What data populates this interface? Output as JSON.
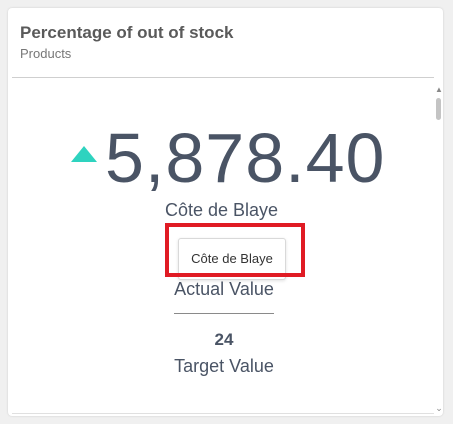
{
  "widget": {
    "title": "Percentage of out of stock",
    "subtitle": "Products"
  },
  "kpi": {
    "trend_icon": "triangle-up-icon",
    "trend_color": "#2ed3bf",
    "value": "5,878.40",
    "category": "Côte de Blaye",
    "actual_label": "Actual Value",
    "target_value": "24",
    "target_label": "Target Value"
  },
  "tooltip": {
    "text": "Côte de Blaye"
  },
  "highlight": {
    "color": "#e01b24"
  },
  "scrollbar": {
    "up_icon": "scroll-up-icon",
    "down_icon": "scroll-down-icon"
  }
}
